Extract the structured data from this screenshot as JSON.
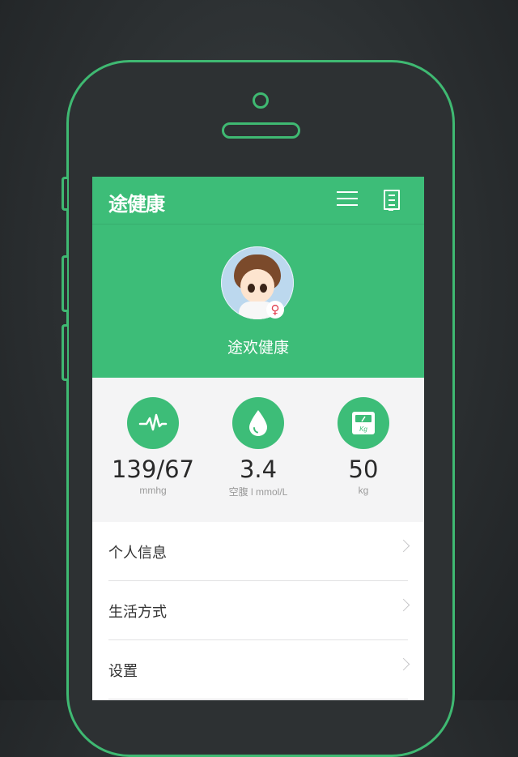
{
  "app": {
    "logo": "途健康"
  },
  "profile": {
    "name": "途欢健康",
    "gender_symbol": "♀"
  },
  "stats": [
    {
      "icon": "heartbeat-icon",
      "value": "139/67",
      "unit": "mmhg"
    },
    {
      "icon": "drop-icon",
      "value": "3.4",
      "unit": "空腹 l mmol/L"
    },
    {
      "icon": "scale-icon",
      "value": "50",
      "unit": "kg"
    }
  ],
  "menu": [
    {
      "label": "个人信息"
    },
    {
      "label": "生活方式"
    },
    {
      "label": "设置"
    }
  ],
  "colors": {
    "brand": "#3dbd78",
    "phone_outline": "#3fb972",
    "background": "#2b2f31"
  },
  "scale_icon_text": "Kg"
}
